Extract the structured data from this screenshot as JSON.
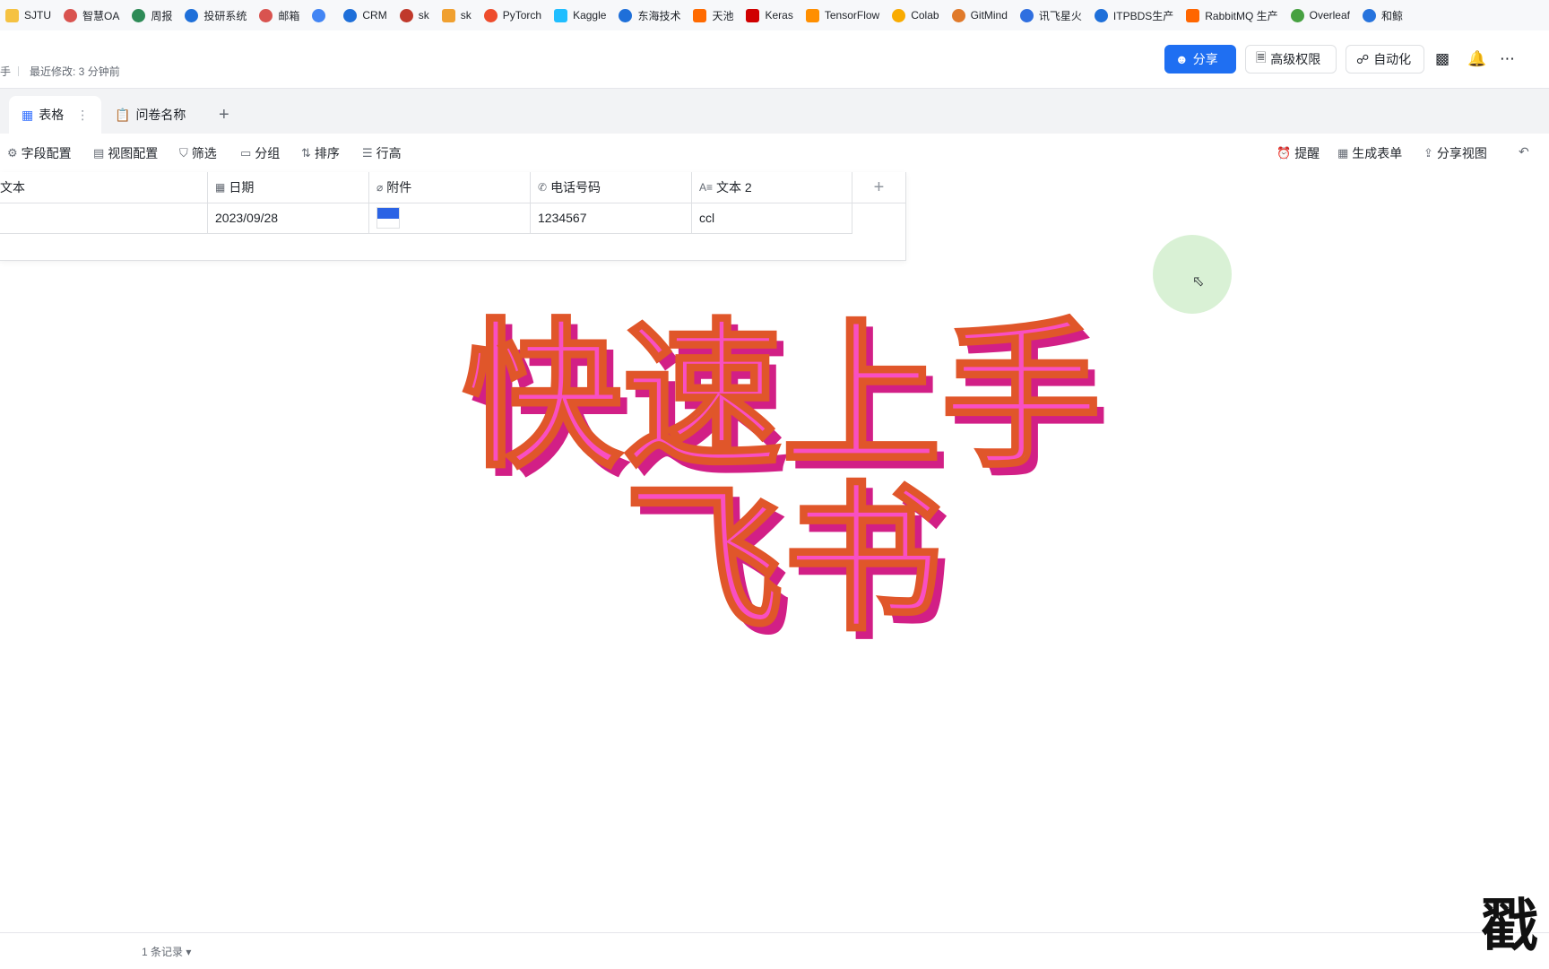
{
  "bookmarks": [
    {
      "label": "SJTU",
      "color": "#f5c242"
    },
    {
      "label": "智慧OA",
      "color": "#d9534f"
    },
    {
      "label": "周报",
      "color": "#2e8b57"
    },
    {
      "label": "投研系统",
      "color": "#1e6fd9"
    },
    {
      "label": "邮箱",
      "color": "#d9534f"
    },
    {
      "label": "",
      "color": "#4285f4"
    },
    {
      "label": "CRM",
      "color": "#1e6fd9"
    },
    {
      "label": "sk",
      "color": "#c0392b"
    },
    {
      "label": "sk",
      "color": "#f0a030"
    },
    {
      "label": "PyTorch",
      "color": "#ee4c2c"
    },
    {
      "label": "Kaggle",
      "color": "#20beff"
    },
    {
      "label": "东海技术",
      "color": "#1e6fd9"
    },
    {
      "label": "天池",
      "color": "#ff6a00"
    },
    {
      "label": "Keras",
      "color": "#d00000"
    },
    {
      "label": "TensorFlow",
      "color": "#ff8f00"
    },
    {
      "label": "Colab",
      "color": "#f9ab00"
    },
    {
      "label": "GitMind",
      "color": "#e07a2a"
    },
    {
      "label": "讯飞星火",
      "color": "#2f6fe0"
    },
    {
      "label": "ITPBDS生产",
      "color": "#1e6fd9"
    },
    {
      "label": "RabbitMQ 生产",
      "color": "#ff6600"
    },
    {
      "label": "Overleaf",
      "color": "#47a141"
    },
    {
      "label": "和鲸",
      "color": "#2673dd"
    }
  ],
  "header": {
    "truncated_title": "手",
    "last_modified": "最近修改: 3 分钟前",
    "share_label": "分享",
    "permissions_label": "高级权限",
    "automation_label": "自动化"
  },
  "tabs": [
    {
      "label": "表格"
    },
    {
      "label": "问卷名称"
    }
  ],
  "toolbar": {
    "left": [
      {
        "label": "字段配置",
        "icon": "⚙"
      },
      {
        "label": "视图配置",
        "icon": "▤"
      },
      {
        "label": "筛选",
        "icon": "⛉"
      },
      {
        "label": "分组",
        "icon": "▭"
      },
      {
        "label": "排序",
        "icon": "⇅"
      },
      {
        "label": "行高",
        "icon": "☰"
      }
    ],
    "right": [
      {
        "label": "提醒",
        "icon": "⏰"
      },
      {
        "label": "生成表单",
        "icon": "▦"
      },
      {
        "label": "分享视图",
        "icon": "⇪"
      }
    ]
  },
  "table": {
    "columns": [
      {
        "label": "文本",
        "icon": ""
      },
      {
        "label": "日期",
        "icon": "▦"
      },
      {
        "label": "附件",
        "icon": "⌀"
      },
      {
        "label": "电话号码",
        "icon": "✆"
      },
      {
        "label": "文本 2",
        "icon": "A≡"
      }
    ],
    "rows": [
      {
        "text": "",
        "date": "2023/09/28",
        "phone": "1234567",
        "text2": "ccl"
      }
    ]
  },
  "overlay": {
    "line1": "快速上手",
    "line2": "飞书"
  },
  "footer": {
    "record_count": "1 条记录"
  },
  "watermark": "戳"
}
